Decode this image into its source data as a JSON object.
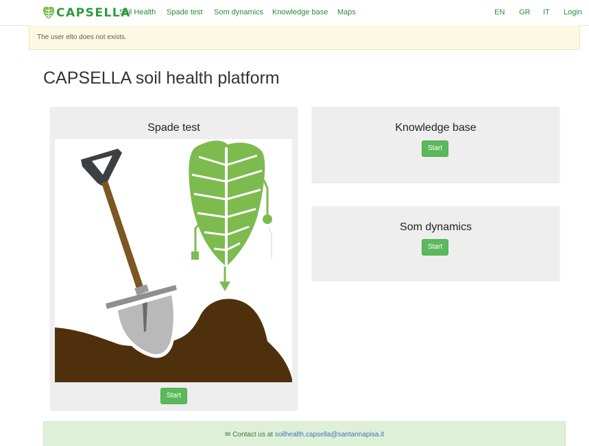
{
  "brand": {
    "name": "CAPSELLA",
    "icon": "capsella-leaf-logo"
  },
  "nav": {
    "left": [
      "Soil Health",
      "Spade test",
      "Som dynamics",
      "Knowledge base",
      "Maps"
    ],
    "right": [
      "EN",
      "GR",
      "IT",
      "Login"
    ]
  },
  "alert": {
    "message": "The user elto does not exists."
  },
  "page": {
    "title": "CAPSELLA soil health platform"
  },
  "cards": {
    "spade": {
      "title": "Spade test",
      "button": "Start",
      "illustration": "spade-and-leaf-illustration"
    },
    "knowledge": {
      "title": "Knowledge base",
      "button": "Start"
    },
    "som": {
      "title": "Som dynamics",
      "button": "Start"
    }
  },
  "footer": {
    "prefix": "Contact us at",
    "email": "soilhealth.capsella@santannapisa.it",
    "icon": "envelope-icon"
  },
  "colors": {
    "brand_green": "#2e9a3e",
    "button_green": "#5cb85c",
    "alert_bg": "#fcf8e3",
    "footer_bg": "#dff0d8",
    "soil_brown": "#4e310c",
    "leaf_green": "#7dbb4f"
  }
}
